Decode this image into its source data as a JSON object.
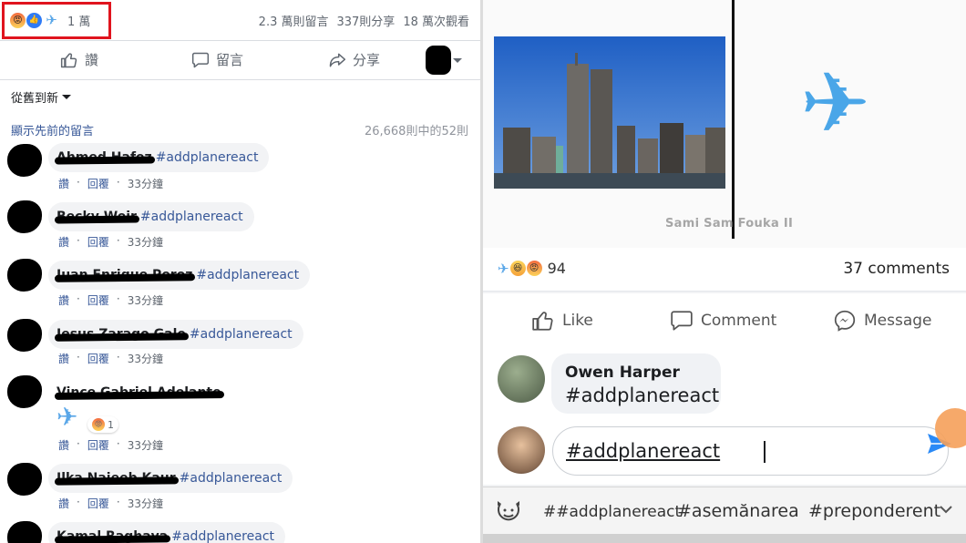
{
  "left": {
    "reaction_count": "1 萬",
    "stats": {
      "comments": "2.3 萬則留言",
      "shares": "337則分享",
      "views": "18 萬次觀看"
    },
    "actions": {
      "like": "讚",
      "comment": "留言",
      "share": "分享"
    },
    "sort_label": "從舊到新",
    "prev_comments_link": "顯示先前的留言",
    "comment_count": "26,668則中的52則",
    "comments": [
      {
        "name": "Ahmed Hafez",
        "tag": "#addplanereact",
        "like": "讚",
        "reply": "回覆",
        "time": "33分鐘"
      },
      {
        "name": "Becky Weir",
        "tag": "#addplanereact",
        "like": "讚",
        "reply": "回覆",
        "time": "33分鐘"
      },
      {
        "name": "Juan Enrique Perez",
        "tag": "#addplanereact",
        "like": "讚",
        "reply": "回覆",
        "time": "33分鐘"
      },
      {
        "name": "Jesus Zarago Gale",
        "tag": "#addplanereact",
        "like": "讚",
        "reply": "回覆",
        "time": "33分鐘"
      },
      {
        "name": "Vince Gabriel Adelante",
        "tag": "",
        "like": "讚",
        "reply": "回覆",
        "time": "33分鐘",
        "reaction_count": "1"
      },
      {
        "name": "Ilka Najeeb Kaur",
        "tag": "#addplanereact",
        "like": "讚",
        "reply": "回覆",
        "time": "33分鐘"
      },
      {
        "name": "Kamal Raghava",
        "tag": "#addplanereact"
      }
    ]
  },
  "right": {
    "image_credit": "Sami Sam Fouka II",
    "reaction_count": "94",
    "comments_count": "37 comments",
    "actions": {
      "like": "Like",
      "comment": "Comment",
      "message": "Message"
    },
    "comment": {
      "name": "Owen Harper",
      "text": "#addplanereact"
    },
    "compose_text": "#addplanereact",
    "suggestions": [
      "##addplanereact",
      "#asemănarea",
      "#preponderent"
    ]
  },
  "colors": {
    "highlight_box": "#e0141e",
    "link": "#385898",
    "plane": "#4aa6e8",
    "send": "#2b8af6"
  }
}
